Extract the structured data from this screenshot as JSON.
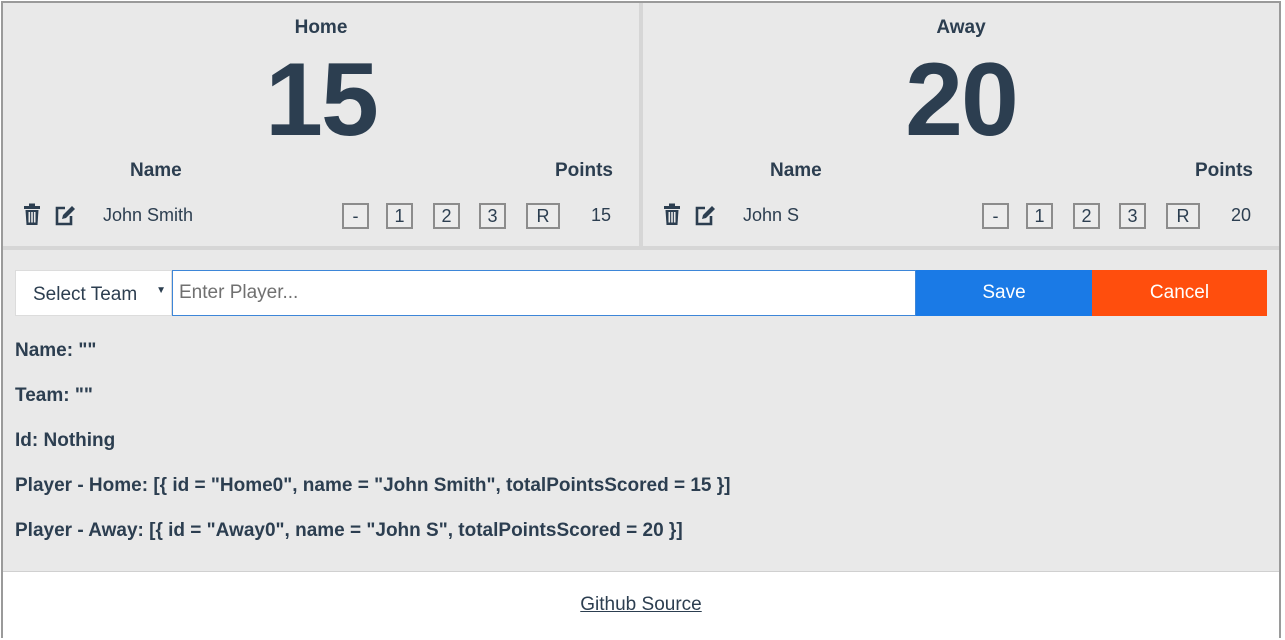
{
  "teams": {
    "home": {
      "title": "Home",
      "score": "15",
      "name_header": "Name",
      "points_header": "Points",
      "player": {
        "name": "John Smith",
        "total": "15"
      }
    },
    "away": {
      "title": "Away",
      "score": "20",
      "name_header": "Name",
      "points_header": "Points",
      "player": {
        "name": "John S",
        "total": "20"
      }
    }
  },
  "point_buttons": [
    "-",
    "1",
    "2",
    "3",
    "R"
  ],
  "form": {
    "select_label": "Select Team",
    "player_placeholder": "Enter Player...",
    "save_label": "Save",
    "cancel_label": "Cancel"
  },
  "debug": {
    "name": "Name: \"\"",
    "team": "Team: \"\"",
    "id": "Id: Nothing",
    "player_home": "Player - Home: [{ id = \"Home0\", name = \"John Smith\", totalPointsScored = 15 }]",
    "player_away": "Player - Away: [{ id = \"Away0\", name = \"John S\", totalPointsScored = 20 }]"
  },
  "footer": {
    "link_label": "Github Source"
  },
  "colors": {
    "text": "#2c3e50",
    "panel_bg": "#e9e9e9",
    "save": "#1a7ae6",
    "cancel": "#ff4e0d"
  },
  "icons": {
    "delete": "trash-icon",
    "edit": "edit-icon",
    "dropdown": "caret-down-icon"
  }
}
